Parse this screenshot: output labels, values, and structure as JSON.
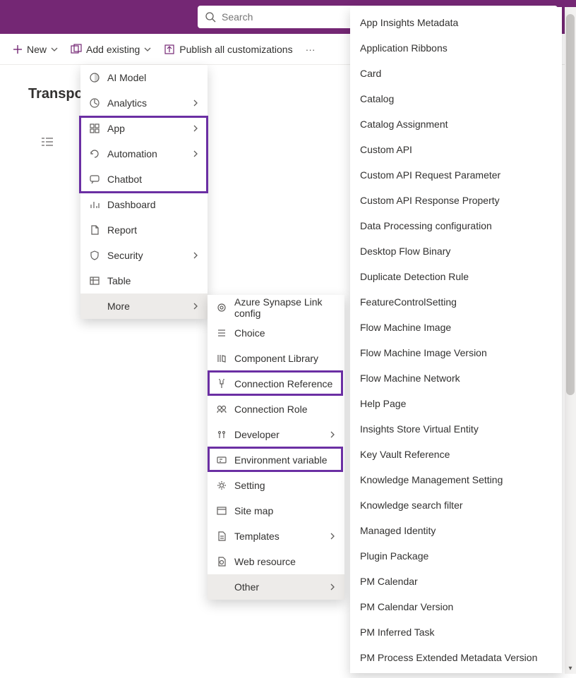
{
  "search": {
    "placeholder": "Search"
  },
  "commands": {
    "new": "New",
    "add_existing": "Add existing",
    "publish": "Publish all customizations"
  },
  "page": {
    "title": "Transport"
  },
  "new_menu": {
    "items": [
      {
        "label": "AI Model",
        "chev": false
      },
      {
        "label": "Analytics",
        "chev": true
      },
      {
        "label": "App",
        "chev": true
      },
      {
        "label": "Automation",
        "chev": true
      },
      {
        "label": "Chatbot",
        "chev": false
      },
      {
        "label": "Dashboard",
        "chev": false
      },
      {
        "label": "Report",
        "chev": false
      },
      {
        "label": "Security",
        "chev": true
      },
      {
        "label": "Table",
        "chev": false
      },
      {
        "label": "More",
        "chev": true,
        "selected": true
      }
    ]
  },
  "more_menu": {
    "items": [
      {
        "label": "Azure Synapse Link config",
        "chev": false
      },
      {
        "label": "Choice",
        "chev": false
      },
      {
        "label": "Component Library",
        "chev": false
      },
      {
        "label": "Connection Reference",
        "chev": false
      },
      {
        "label": "Connection Role",
        "chev": false
      },
      {
        "label": "Developer",
        "chev": true
      },
      {
        "label": "Environment variable",
        "chev": false
      },
      {
        "label": "Setting",
        "chev": false
      },
      {
        "label": "Site map",
        "chev": false
      },
      {
        "label": "Templates",
        "chev": true
      },
      {
        "label": "Web resource",
        "chev": false
      },
      {
        "label": "Other",
        "chev": true,
        "selected": true
      }
    ]
  },
  "other_menu": {
    "items": [
      "App Insights Metadata",
      "Application Ribbons",
      "Card",
      "Catalog",
      "Catalog Assignment",
      "Custom API",
      "Custom API Request Parameter",
      "Custom API Response Property",
      "Data Processing configuration",
      "Desktop Flow Binary",
      "Duplicate Detection Rule",
      "FeatureControlSetting",
      "Flow Machine Image",
      "Flow Machine Image Version",
      "Flow Machine Network",
      "Help Page",
      "Insights Store Virtual Entity",
      "Key Vault Reference",
      "Knowledge Management Setting",
      "Knowledge search filter",
      "Managed Identity",
      "Plugin Package",
      "PM Calendar",
      "PM Calendar Version",
      "PM Inferred Task",
      "PM Process Extended Metadata Version"
    ]
  }
}
